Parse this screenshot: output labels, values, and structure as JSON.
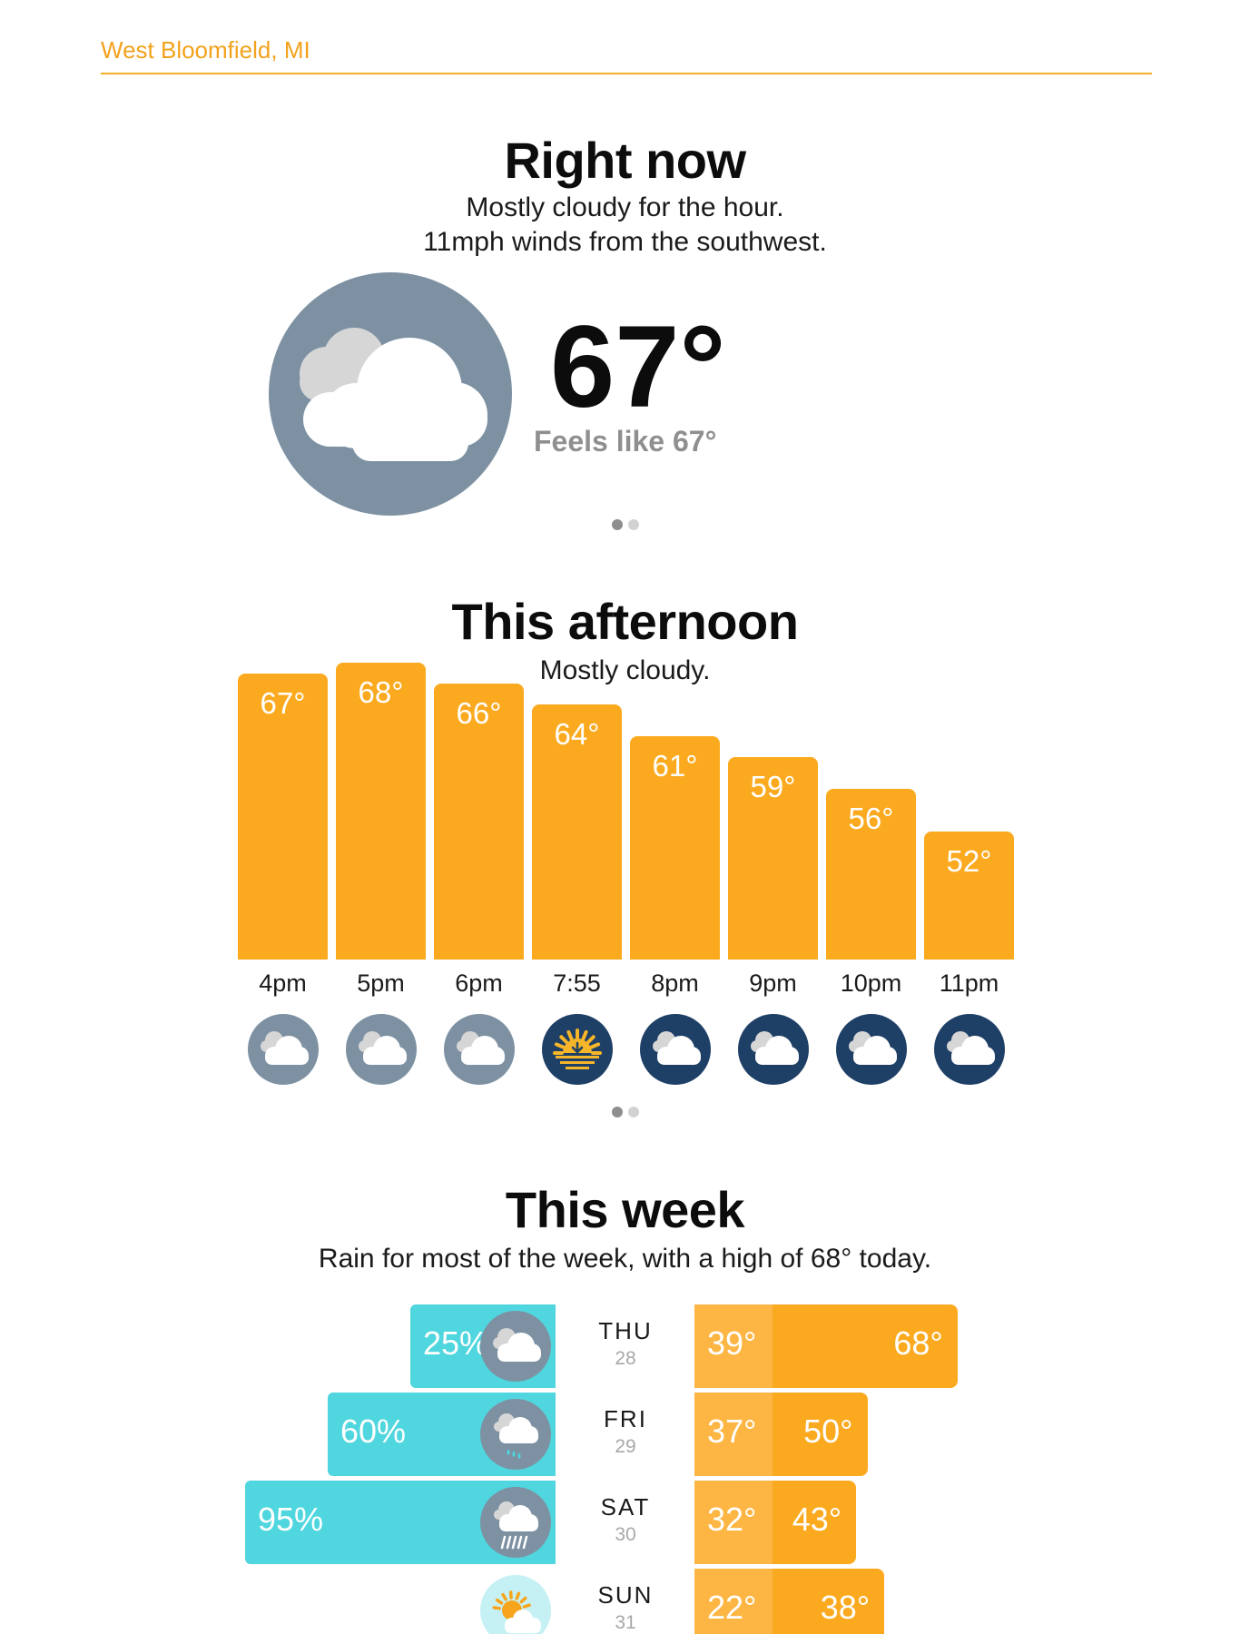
{
  "header": {
    "location": "West Bloomfield, MI"
  },
  "colors": {
    "accent": "#f2a21c",
    "bar": "#fbaa20",
    "rain": "#4fd6de",
    "day_icon_bg": "#7d91a3",
    "night_icon_bg": "#1e3f66"
  },
  "now": {
    "title": "Right now",
    "line1": "Mostly cloudy for the hour.",
    "line2": "11mph winds from the southwest.",
    "icon": "partly-cloudy-icon",
    "temp": "67°",
    "feels": "Feels like 67°"
  },
  "afternoon": {
    "title": "This afternoon",
    "summary": "Mostly cloudy.",
    "hours": [
      {
        "label": "4pm",
        "temp": "67°",
        "value": 67,
        "icon": "cloudy-day-icon"
      },
      {
        "label": "5pm",
        "temp": "68°",
        "value": 68,
        "icon": "cloudy-day-icon"
      },
      {
        "label": "6pm",
        "temp": "66°",
        "value": 66,
        "icon": "cloudy-day-icon"
      },
      {
        "label": "7:55",
        "temp": "64°",
        "value": 64,
        "icon": "sunset-icon"
      },
      {
        "label": "8pm",
        "temp": "61°",
        "value": 61,
        "icon": "cloudy-night-icon"
      },
      {
        "label": "9pm",
        "temp": "59°",
        "value": 59,
        "icon": "cloudy-night-icon"
      },
      {
        "label": "10pm",
        "temp": "56°",
        "value": 56,
        "icon": "cloudy-night-icon"
      },
      {
        "label": "11pm",
        "temp": "52°",
        "value": 52,
        "icon": "cloudy-night-icon"
      }
    ]
  },
  "week": {
    "title": "This week",
    "summary": "Rain for most of the week, with a high of 68° today.",
    "days": [
      {
        "day": "THU",
        "date": "28",
        "rain": "25%",
        "rain_value": 25,
        "icon": "cloudy-icon",
        "low": "39°",
        "high": "68°",
        "low_value": 39,
        "high_value": 68
      },
      {
        "day": "FRI",
        "date": "29",
        "rain": "60%",
        "rain_value": 60,
        "icon": "rain-icon",
        "low": "37°",
        "high": "50°",
        "low_value": 37,
        "high_value": 50
      },
      {
        "day": "SAT",
        "date": "30",
        "rain": "95%",
        "rain_value": 95,
        "icon": "heavy-rain-icon",
        "low": "32°",
        "high": "43°",
        "low_value": 32,
        "high_value": 43
      },
      {
        "day": "SUN",
        "date": "31",
        "rain": "",
        "rain_value": 0,
        "icon": "partly-sunny-icon",
        "low": "22°",
        "high": "38°",
        "low_value": 22,
        "high_value": 38
      }
    ]
  }
}
